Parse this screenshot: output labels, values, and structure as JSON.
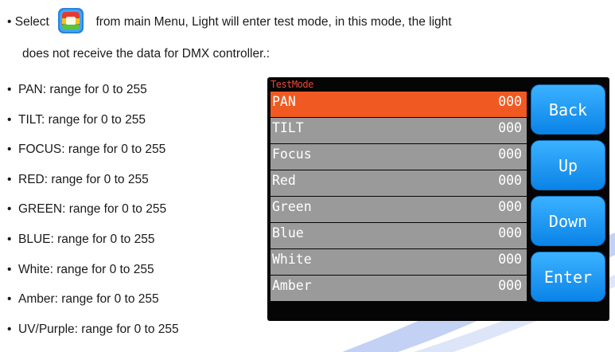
{
  "intro": {
    "prefix": "Select",
    "after_icon": "from main Menu, Light will enter test mode, in this mode, the light",
    "line2": "does not receive the data for DMX controller.:",
    "icon": "test-mode-icon"
  },
  "bullets": [
    "PAN: range for 0 to 255",
    "TILT: range for 0 to 255",
    "FOCUS: range for 0 to 255",
    "RED: range for 0 to 255",
    "GREEN: range for 0 to 255",
    "BLUE: range for 0 to 255",
    "White: range for 0 to 255",
    "Amber: range for 0 to 255",
    "UV/Purple: range for 0 to 255"
  ],
  "bullet_char": "•",
  "screen": {
    "title": "TestMode",
    "rows": [
      {
        "name": "PAN",
        "value": "000"
      },
      {
        "name": "TILT",
        "value": "000"
      },
      {
        "name": "Focus",
        "value": "000"
      },
      {
        "name": "Red",
        "value": "000"
      },
      {
        "name": "Green",
        "value": "000"
      },
      {
        "name": "Blue",
        "value": "000"
      },
      {
        "name": "White",
        "value": "000"
      },
      {
        "name": "Amber",
        "value": "000"
      }
    ],
    "buttons": {
      "back": "Back",
      "up": "Up",
      "down": "Down",
      "enter": "Enter"
    },
    "colors": {
      "active_row": "#f05a22",
      "row": "#9a9a9a",
      "button": "#1a9af5",
      "title": "#e8483a"
    }
  }
}
